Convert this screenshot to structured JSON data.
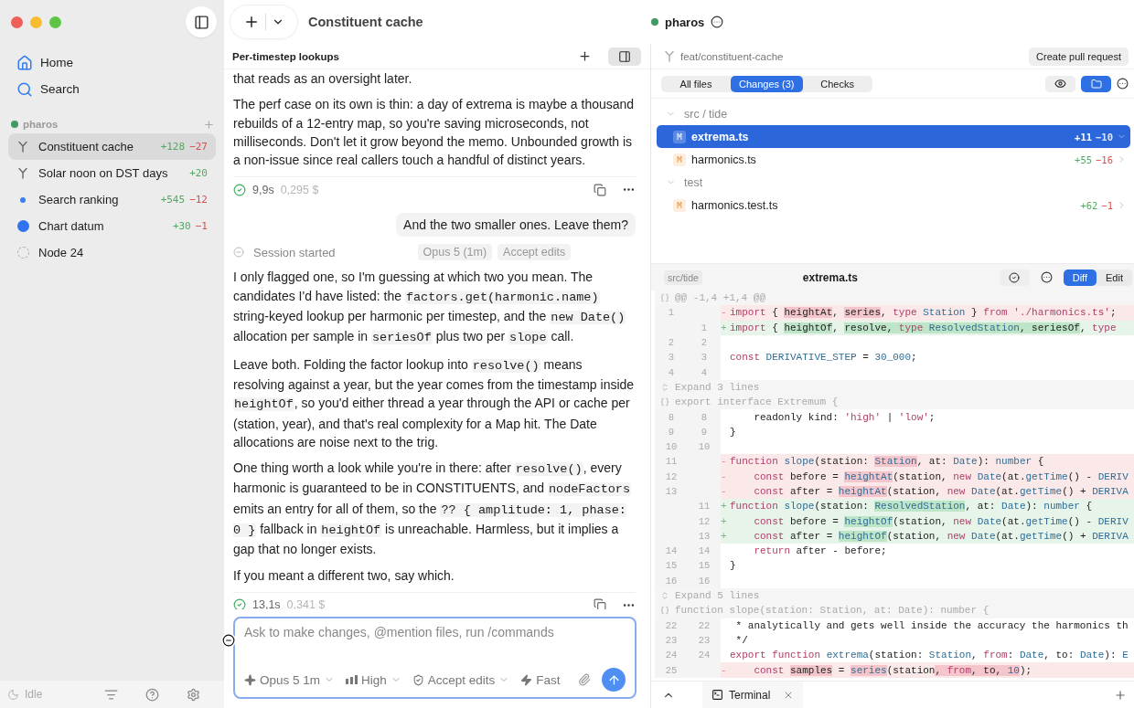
{
  "sidebar": {
    "nav": [
      {
        "kind": "home",
        "label": "Home"
      },
      {
        "kind": "search",
        "label": "Search"
      }
    ],
    "project": {
      "name": "pharos",
      "items": [
        {
          "kind": "branch",
          "label": "Constituent cache",
          "added": "+128",
          "removed": "−27",
          "selected": true
        },
        {
          "kind": "branch",
          "label": "Solar noon on DST days",
          "added": "+20",
          "selected": false
        },
        {
          "kind": "dot",
          "label": "Search ranking",
          "added": "+545",
          "removed": "−12",
          "selected": false
        },
        {
          "kind": "disc",
          "label": "Chart datum",
          "added": "+30",
          "removed": "−1",
          "selected": false
        },
        {
          "kind": "ring",
          "label": "Node 24",
          "selected": false
        }
      ]
    },
    "status": "Idle"
  },
  "header": {
    "title": "Constituent cache",
    "project": "pharos"
  },
  "chat": {
    "title": "Per-timestep lookups",
    "messages": [
      {
        "kind": "assistant",
        "paragraphs": [
          [
            {
              "text": "that reads as an oversight later.",
              "code": false
            }
          ],
          [
            {
              "text": "The perf case on its own is thin: a day of extrema is maybe a thousand rebuilds of a 12-entry map, so you're saving microseconds, not milliseconds. Don't let it grow beyond the memo. Unbounded growth is a non-issue since real callers touch a handful of distinct years.",
              "code": false
            }
          ]
        ],
        "duration": "9,9s",
        "cost": "0,295 $"
      },
      {
        "kind": "user",
        "text": "And the two smaller ones. Leave them?"
      },
      {
        "kind": "session",
        "text": "Session started",
        "chips": [
          "Opus 5 (1m)",
          "Accept edits"
        ]
      },
      {
        "kind": "assistant",
        "paragraphs": [
          [
            {
              "text": "I only flagged one, so I'm guessing at which two you mean. The candidates I'd have listed: the ",
              "code": false
            },
            {
              "text": "factors.get(harmonic.name)",
              "code": true
            },
            {
              "text": " string-keyed lookup per harmonic per timestep, and the ",
              "code": false
            },
            {
              "text": "new Date()",
              "code": true
            },
            {
              "text": " allocation per sample in ",
              "code": false
            },
            {
              "text": "seriesOf",
              "code": true
            },
            {
              "text": " plus two per ",
              "code": false
            },
            {
              "text": "slope",
              "code": true
            },
            {
              "text": " call.",
              "code": false
            }
          ],
          [
            {
              "text": "Leave both. Folding the factor lookup into ",
              "code": false
            },
            {
              "text": "resolve()",
              "code": true
            },
            {
              "text": " means resolving against a year, but the year comes from the timestamp inside ",
              "code": false
            },
            {
              "text": "heightOf",
              "code": true
            },
            {
              "text": ", so you'd either thread a year through the API or cache per (station, year), and that's real complexity for a Map hit. The Date allocations are noise next to the trig.",
              "code": false
            }
          ],
          [
            {
              "text": "One thing worth a look while you're in there: after ",
              "code": false
            },
            {
              "text": "resolve()",
              "code": true
            },
            {
              "text": ", every harmonic is guaranteed to be in CONSTITUENTS, and ",
              "code": false
            },
            {
              "text": "nodeFactors",
              "code": true
            },
            {
              "text": " emits an entry for all of them, so the ",
              "code": false
            },
            {
              "text": "?? { amplitude: 1, phase: 0 }",
              "code": true
            },
            {
              "text": " fallback in ",
              "code": false
            },
            {
              "text": "heightOf",
              "code": true
            },
            {
              "text": " is unreachable. Harmless, but it implies a gap that no longer exists.",
              "code": false
            }
          ],
          [
            {
              "text": "If you meant a different two, say which.",
              "code": false
            }
          ]
        ],
        "duration": "13,1s",
        "cost": "0,341 $"
      }
    ],
    "composer": {
      "placeholder": "Ask to make changes, @mention files, run /commands",
      "options": [
        {
          "kind": "model",
          "label": "Opus 5 1m"
        },
        {
          "kind": "effort",
          "label": "High"
        },
        {
          "kind": "mode",
          "label": "Accept edits"
        },
        {
          "kind": "speed",
          "label": "Fast"
        }
      ]
    }
  },
  "changes": {
    "branch": "feat/constituent-cache",
    "action": "Create pull request",
    "tabs": [
      {
        "label": "All files",
        "selected": false
      },
      {
        "label": "Changes (3)",
        "selected": true
      },
      {
        "label": "Checks",
        "selected": false
      }
    ],
    "folder_view": true,
    "tree": [
      {
        "label": "src / tide",
        "expanded": true,
        "children": [
          {
            "label": "extrema.ts",
            "status": "M",
            "added": "+11",
            "removed": "−10",
            "selected": true
          },
          {
            "label": "harmonics.ts",
            "status": "M",
            "added": "+55",
            "removed": "−16",
            "selected": false
          }
        ]
      },
      {
        "label": "test",
        "expanded": true,
        "children": [
          {
            "label": "harmonics.test.ts",
            "status": "M",
            "added": "+62",
            "removed": "−1",
            "selected": false
          }
        ]
      }
    ],
    "file": {
      "path": "src/tide",
      "name": "extrema.ts",
      "views": [
        {
          "label": "Diff",
          "selected": true
        },
        {
          "label": "Edit",
          "selected": false
        }
      ]
    },
    "diff": [
      {
        "kind": "hunk",
        "text": "@@ -1,4 +1,4 @@"
      },
      {
        "kind": "del",
        "old": "1",
        "sign": "-",
        "tokens": [
          {
            "text": "import",
            "kind": "kw",
            "marked": false
          },
          {
            "text": " { ",
            "kind": "plain",
            "marked": false
          },
          {
            "text": "heightAt",
            "kind": "plain",
            "marked": true
          },
          {
            "text": ", ",
            "kind": "plain",
            "marked": false
          },
          {
            "text": "series",
            "kind": "plain",
            "marked": true
          },
          {
            "text": ", ",
            "kind": "plain",
            "marked": false
          },
          {
            "text": "type",
            "kind": "kw",
            "marked": false
          },
          {
            "text": " Station",
            "kind": "name",
            "marked": false
          },
          {
            "text": " } ",
            "kind": "plain",
            "marked": false
          },
          {
            "text": "from",
            "kind": "kw",
            "marked": false
          },
          {
            "text": " './harmonics.ts'",
            "kind": "kw",
            "marked": false
          },
          {
            "text": ";",
            "kind": "plain",
            "marked": false
          }
        ]
      },
      {
        "kind": "add",
        "new": "1",
        "sign": "+",
        "tokens": [
          {
            "text": "import",
            "kind": "kw",
            "marked": false
          },
          {
            "text": " { ",
            "kind": "plain",
            "marked": false
          },
          {
            "text": "heightOf",
            "kind": "plain",
            "marked": true
          },
          {
            "text": ", ",
            "kind": "plain",
            "marked": false
          },
          {
            "text": "resolve, ",
            "kind": "plain",
            "marked": true
          },
          {
            "text": "type",
            "kind": "kw",
            "marked": true
          },
          {
            "text": " ResolvedStation",
            "kind": "name",
            "marked": true
          },
          {
            "text": ", seriesOf",
            "kind": "plain",
            "marked": true
          },
          {
            "text": ", ",
            "kind": "plain",
            "marked": false
          },
          {
            "text": "type",
            "kind": "kw",
            "marked": false
          }
        ]
      },
      {
        "kind": "ctx",
        "old": "2",
        "new": "2"
      },
      {
        "kind": "ctx",
        "old": "3",
        "new": "3",
        "tokens": [
          {
            "text": "const",
            "kind": "kw",
            "marked": false
          },
          {
            "text": " DERIVATIVE_STEP",
            "kind": "name",
            "marked": false
          },
          {
            "text": " = ",
            "kind": "plain",
            "marked": false
          },
          {
            "text": "30_000",
            "kind": "name",
            "marked": false
          },
          {
            "text": ";",
            "kind": "plain",
            "marked": false
          }
        ]
      },
      {
        "kind": "ctx",
        "old": "4",
        "new": "4"
      },
      {
        "kind": "expand",
        "text": "Expand 3 lines"
      },
      {
        "kind": "hunk",
        "text": "export interface Extremum {"
      },
      {
        "kind": "ctx",
        "old": "8",
        "new": "8",
        "tokens": [
          {
            "text": "    readonly kind: ",
            "kind": "plain",
            "marked": false
          },
          {
            "text": "'high'",
            "kind": "kw",
            "marked": false
          },
          {
            "text": " | ",
            "kind": "plain",
            "marked": false
          },
          {
            "text": "'low'",
            "kind": "kw",
            "marked": false
          },
          {
            "text": ";",
            "kind": "plain",
            "marked": false
          }
        ]
      },
      {
        "kind": "ctx",
        "old": "9",
        "new": "9",
        "tokens": [
          {
            "text": "}",
            "kind": "plain",
            "marked": false
          }
        ]
      },
      {
        "kind": "ctx",
        "old": "10",
        "new": "10"
      },
      {
        "kind": "del",
        "old": "11",
        "sign": "-",
        "tokens": [
          {
            "text": "function",
            "kind": "kw",
            "marked": false
          },
          {
            "text": " slope",
            "kind": "name",
            "marked": false
          },
          {
            "text": "(station: ",
            "kind": "plain",
            "marked": false
          },
          {
            "text": "Station",
            "kind": "name",
            "marked": true
          },
          {
            "text": ", at: ",
            "kind": "plain",
            "marked": false
          },
          {
            "text": "Date",
            "kind": "name",
            "marked": false
          },
          {
            "text": "): ",
            "kind": "plain",
            "marked": false
          },
          {
            "text": "number",
            "kind": "name",
            "marked": false
          },
          {
            "text": " {",
            "kind": "plain",
            "marked": false
          }
        ]
      },
      {
        "kind": "del",
        "old": "12",
        "sign": "-",
        "tokens": [
          {
            "text": "    const",
            "kind": "kw",
            "marked": false
          },
          {
            "text": " before = ",
            "kind": "plain",
            "marked": false
          },
          {
            "text": "heightAt",
            "kind": "name",
            "marked": true
          },
          {
            "text": "(station, ",
            "kind": "plain",
            "marked": false
          },
          {
            "text": "new",
            "kind": "kw",
            "marked": false
          },
          {
            "text": " Date",
            "kind": "name",
            "marked": false
          },
          {
            "text": "(at.",
            "kind": "plain",
            "marked": false
          },
          {
            "text": "getTime",
            "kind": "name",
            "marked": false
          },
          {
            "text": "() - ",
            "kind": "plain",
            "marked": false
          },
          {
            "text": "DERIV",
            "kind": "name",
            "marked": false
          }
        ]
      },
      {
        "kind": "del",
        "old": "13",
        "sign": "-",
        "tokens": [
          {
            "text": "    const",
            "kind": "kw",
            "marked": false
          },
          {
            "text": " after = ",
            "kind": "plain",
            "marked": false
          },
          {
            "text": "heightAt",
            "kind": "name",
            "marked": true
          },
          {
            "text": "(station, ",
            "kind": "plain",
            "marked": false
          },
          {
            "text": "new",
            "kind": "kw",
            "marked": false
          },
          {
            "text": " Date",
            "kind": "name",
            "marked": false
          },
          {
            "text": "(at.",
            "kind": "plain",
            "marked": false
          },
          {
            "text": "getTime",
            "kind": "name",
            "marked": false
          },
          {
            "text": "() + ",
            "kind": "plain",
            "marked": false
          },
          {
            "text": "DERIVA",
            "kind": "name",
            "marked": false
          }
        ]
      },
      {
        "kind": "add",
        "new": "11",
        "sign": "+",
        "tokens": [
          {
            "text": "function",
            "kind": "kw",
            "marked": false
          },
          {
            "text": " slope",
            "kind": "name",
            "marked": false
          },
          {
            "text": "(station: ",
            "kind": "plain",
            "marked": false
          },
          {
            "text": "ResolvedStation",
            "kind": "name",
            "marked": true
          },
          {
            "text": ", at: ",
            "kind": "plain",
            "marked": false
          },
          {
            "text": "Date",
            "kind": "name",
            "marked": false
          },
          {
            "text": "): ",
            "kind": "plain",
            "marked": false
          },
          {
            "text": "number",
            "kind": "name",
            "marked": false
          },
          {
            "text": " {",
            "kind": "plain",
            "marked": false
          }
        ]
      },
      {
        "kind": "add",
        "new": "12",
        "sign": "+",
        "tokens": [
          {
            "text": "    const",
            "kind": "kw",
            "marked": false
          },
          {
            "text": " before = ",
            "kind": "plain",
            "marked": false
          },
          {
            "text": "heightOf",
            "kind": "name",
            "marked": true
          },
          {
            "text": "(station, ",
            "kind": "plain",
            "marked": false
          },
          {
            "text": "new",
            "kind": "kw",
            "marked": false
          },
          {
            "text": " Date",
            "kind": "name",
            "marked": false
          },
          {
            "text": "(at.",
            "kind": "plain",
            "marked": false
          },
          {
            "text": "getTime",
            "kind": "name",
            "marked": false
          },
          {
            "text": "() - ",
            "kind": "plain",
            "marked": false
          },
          {
            "text": "DERIV",
            "kind": "name",
            "marked": false
          }
        ]
      },
      {
        "kind": "add",
        "new": "13",
        "sign": "+",
        "tokens": [
          {
            "text": "    const",
            "kind": "kw",
            "marked": false
          },
          {
            "text": " after = ",
            "kind": "plain",
            "marked": false
          },
          {
            "text": "heightOf",
            "kind": "name",
            "marked": true
          },
          {
            "text": "(station, ",
            "kind": "plain",
            "marked": false
          },
          {
            "text": "new",
            "kind": "kw",
            "marked": false
          },
          {
            "text": " Date",
            "kind": "name",
            "marked": false
          },
          {
            "text": "(at.",
            "kind": "plain",
            "marked": false
          },
          {
            "text": "getTime",
            "kind": "name",
            "marked": false
          },
          {
            "text": "() + ",
            "kind": "plain",
            "marked": false
          },
          {
            "text": "DERIVA",
            "kind": "name",
            "marked": false
          }
        ]
      },
      {
        "kind": "ctx",
        "old": "14",
        "new": "14",
        "tokens": [
          {
            "text": "    return",
            "kind": "kw",
            "marked": false
          },
          {
            "text": " after - before;",
            "kind": "plain",
            "marked": false
          }
        ]
      },
      {
        "kind": "ctx",
        "old": "15",
        "new": "15",
        "tokens": [
          {
            "text": "}",
            "kind": "plain",
            "marked": false
          }
        ]
      },
      {
        "kind": "ctx",
        "old": "16",
        "new": "16"
      },
      {
        "kind": "expand",
        "text": "Expand 5 lines"
      },
      {
        "kind": "hunk",
        "text": "function slope(station: Station, at: Date): number {"
      },
      {
        "kind": "ctx",
        "old": "22",
        "new": "22",
        "tokens": [
          {
            "text": " * analytically and gets well inside the accuracy the harmonics th",
            "kind": "plain",
            "marked": false
          }
        ]
      },
      {
        "kind": "ctx",
        "old": "23",
        "new": "23",
        "tokens": [
          {
            "text": " */",
            "kind": "plain",
            "marked": false
          }
        ]
      },
      {
        "kind": "ctx",
        "old": "24",
        "new": "24",
        "tokens": [
          {
            "text": "export function",
            "kind": "kw",
            "marked": false
          },
          {
            "text": " extrema",
            "kind": "name",
            "marked": false
          },
          {
            "text": "(station: ",
            "kind": "plain",
            "marked": false
          },
          {
            "text": "Station",
            "kind": "name",
            "marked": false
          },
          {
            "text": ", ",
            "kind": "plain",
            "marked": false
          },
          {
            "text": "from",
            "kind": "kw",
            "marked": false
          },
          {
            "text": ": ",
            "kind": "plain",
            "marked": false
          },
          {
            "text": "Date",
            "kind": "name",
            "marked": false
          },
          {
            "text": ", to: ",
            "kind": "plain",
            "marked": false
          },
          {
            "text": "Date",
            "kind": "name",
            "marked": false
          },
          {
            "text": "): ",
            "kind": "plain",
            "marked": false
          },
          {
            "text": "E",
            "kind": "name",
            "marked": false
          }
        ]
      },
      {
        "kind": "del",
        "old": "25",
        "sign": "-",
        "tokens": [
          {
            "text": "    const ",
            "kind": "kw",
            "marked": false
          },
          {
            "text": "samples",
            "kind": "plain",
            "marked": true
          },
          {
            "text": " = ",
            "kind": "plain",
            "marked": false
          },
          {
            "text": "series",
            "kind": "name",
            "marked": true
          },
          {
            "text": "(station",
            "kind": "plain",
            "marked": false
          },
          {
            "text": ", ",
            "kind": "plain",
            "marked": true
          },
          {
            "text": "from",
            "kind": "kw",
            "marked": true
          },
          {
            "text": ", to, ",
            "kind": "plain",
            "marked": true
          },
          {
            "text": "10",
            "kind": "name",
            "marked": true
          },
          {
            "text": ");",
            "kind": "plain",
            "marked": false
          }
        ]
      }
    ],
    "terminal": {
      "label": "Terminal"
    }
  }
}
